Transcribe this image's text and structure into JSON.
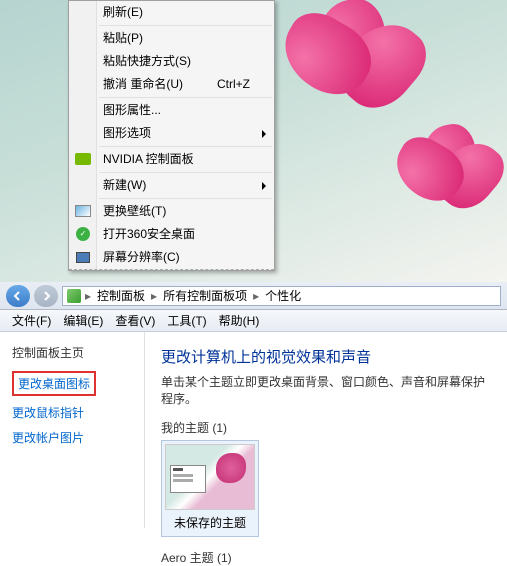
{
  "context_menu": {
    "items": [
      {
        "label": "刷新(E)",
        "has_sep_after": true
      },
      {
        "label": "粘贴(P)"
      },
      {
        "label": "粘贴快捷方式(S)"
      },
      {
        "label": "撤消 重命名(U)",
        "shortcut": "Ctrl+Z",
        "has_sep_after": true
      },
      {
        "label": "图形属性..."
      },
      {
        "label": "图形选项",
        "submenu": true,
        "has_sep_after": true
      },
      {
        "label": "NVIDIA 控制面板",
        "icon": "nvidia",
        "has_sep_after": true
      },
      {
        "label": "新建(W)",
        "submenu": true,
        "has_sep_after": true
      },
      {
        "label": "更换壁纸(T)",
        "icon": "wallpaper"
      },
      {
        "label": "打开360安全桌面",
        "icon": "360"
      },
      {
        "label": "屏幕分辨率(C)",
        "icon": "monitor",
        "truncated": true
      }
    ]
  },
  "window": {
    "breadcrumb": [
      "控制面板",
      "所有控制面板项",
      "个性化"
    ],
    "menu": [
      "文件(F)",
      "编辑(E)",
      "查看(V)",
      "工具(T)",
      "帮助(H)"
    ],
    "sidebar": {
      "title": "控制面板主页",
      "links": [
        {
          "label": "更改桌面图标",
          "highlighted": true
        },
        {
          "label": "更改鼠标指针"
        },
        {
          "label": "更改帐户图片"
        }
      ]
    },
    "content": {
      "title": "更改计算机上的视觉效果和声音",
      "subtitle": "单击某个主题立即更改桌面背景、窗口颜色、声音和屏幕保护程序。",
      "my_themes_label": "我的主题 (1)",
      "theme_name": "未保存的主题",
      "aero_label": "Aero 主题 (1)"
    }
  }
}
